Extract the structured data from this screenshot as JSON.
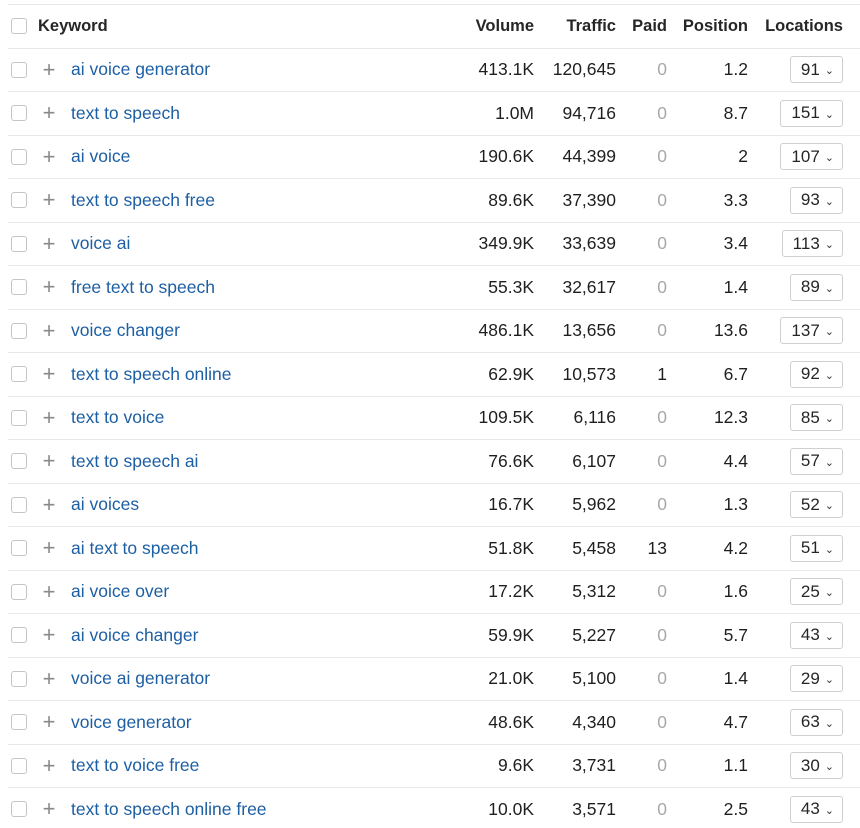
{
  "header": {
    "keyword": "Keyword",
    "volume": "Volume",
    "traffic": "Traffic",
    "paid": "Paid",
    "position": "Position",
    "locations": "Locations"
  },
  "rows": [
    {
      "keyword": "ai voice generator",
      "volume": "413.1K",
      "traffic": "120,645",
      "paid": "0",
      "position": "1.2",
      "locations": "91"
    },
    {
      "keyword": "text to speech",
      "volume": "1.0M",
      "traffic": "94,716",
      "paid": "0",
      "position": "8.7",
      "locations": "151"
    },
    {
      "keyword": "ai voice",
      "volume": "190.6K",
      "traffic": "44,399",
      "paid": "0",
      "position": "2",
      "locations": "107"
    },
    {
      "keyword": "text to speech free",
      "volume": "89.6K",
      "traffic": "37,390",
      "paid": "0",
      "position": "3.3",
      "locations": "93"
    },
    {
      "keyword": "voice ai",
      "volume": "349.9K",
      "traffic": "33,639",
      "paid": "0",
      "position": "3.4",
      "locations": "113"
    },
    {
      "keyword": "free text to speech",
      "volume": "55.3K",
      "traffic": "32,617",
      "paid": "0",
      "position": "1.4",
      "locations": "89"
    },
    {
      "keyword": "voice changer",
      "volume": "486.1K",
      "traffic": "13,656",
      "paid": "0",
      "position": "13.6",
      "locations": "137"
    },
    {
      "keyword": "text to speech online",
      "volume": "62.9K",
      "traffic": "10,573",
      "paid": "1",
      "position": "6.7",
      "locations": "92"
    },
    {
      "keyword": "text to voice",
      "volume": "109.5K",
      "traffic": "6,116",
      "paid": "0",
      "position": "12.3",
      "locations": "85"
    },
    {
      "keyword": "text to speech ai",
      "volume": "76.6K",
      "traffic": "6,107",
      "paid": "0",
      "position": "4.4",
      "locations": "57"
    },
    {
      "keyword": "ai voices",
      "volume": "16.7K",
      "traffic": "5,962",
      "paid": "0",
      "position": "1.3",
      "locations": "52"
    },
    {
      "keyword": "ai text to speech",
      "volume": "51.8K",
      "traffic": "5,458",
      "paid": "13",
      "position": "4.2",
      "locations": "51"
    },
    {
      "keyword": "ai voice over",
      "volume": "17.2K",
      "traffic": "5,312",
      "paid": "0",
      "position": "1.6",
      "locations": "25"
    },
    {
      "keyword": "ai voice changer",
      "volume": "59.9K",
      "traffic": "5,227",
      "paid": "0",
      "position": "5.7",
      "locations": "43"
    },
    {
      "keyword": "voice ai generator",
      "volume": "21.0K",
      "traffic": "5,100",
      "paid": "0",
      "position": "1.4",
      "locations": "29"
    },
    {
      "keyword": "voice generator",
      "volume": "48.6K",
      "traffic": "4,340",
      "paid": "0",
      "position": "4.7",
      "locations": "63"
    },
    {
      "keyword": "text to voice free",
      "volume": "9.6K",
      "traffic": "3,731",
      "paid": "0",
      "position": "1.1",
      "locations": "30"
    },
    {
      "keyword": "text to speech online free",
      "volume": "10.0K",
      "traffic": "3,571",
      "paid": "0",
      "position": "2.5",
      "locations": "43"
    }
  ],
  "icons": {
    "add": "plus-icon",
    "dropdown": "chevron-down-icon"
  },
  "colors": {
    "keyword_link": "#1d5fa3",
    "zero_paid": "#a8a8a8",
    "row_border": "#e8e8e8"
  }
}
